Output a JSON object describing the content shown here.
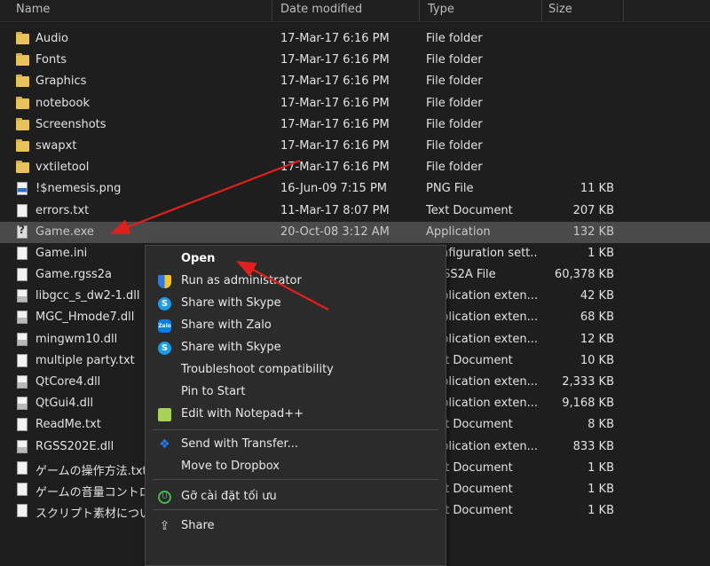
{
  "columns": {
    "name": "Name",
    "date": "Date modified",
    "type": "Type",
    "size": "Size"
  },
  "files": [
    {
      "name": "Audio",
      "date": "17-Mar-17 6:16 PM",
      "type": "File folder",
      "size": "",
      "icon": "folder-icon"
    },
    {
      "name": "Fonts",
      "date": "17-Mar-17 6:16 PM",
      "type": "File folder",
      "size": "",
      "icon": "folder-icon"
    },
    {
      "name": "Graphics",
      "date": "17-Mar-17 6:16 PM",
      "type": "File folder",
      "size": "",
      "icon": "folder-icon"
    },
    {
      "name": "notebook",
      "date": "17-Mar-17 6:16 PM",
      "type": "File folder",
      "size": "",
      "icon": "folder-icon"
    },
    {
      "name": "Screenshots",
      "date": "17-Mar-17 6:16 PM",
      "type": "File folder",
      "size": "",
      "icon": "folder-icon"
    },
    {
      "name": "swapxt",
      "date": "17-Mar-17 6:16 PM",
      "type": "File folder",
      "size": "",
      "icon": "folder-icon"
    },
    {
      "name": "vxtiletool",
      "date": "17-Mar-17 6:16 PM",
      "type": "File folder",
      "size": "",
      "icon": "folder-icon"
    },
    {
      "name": "!$nemesis.png",
      "date": "16-Jun-09 7:15 PM",
      "type": "PNG File",
      "size": "11 KB",
      "icon": "image-file-icon"
    },
    {
      "name": "errors.txt",
      "date": "11-Mar-17 8:07 PM",
      "type": "Text Document",
      "size": "207 KB",
      "icon": "text-file-icon"
    },
    {
      "name": "Game.exe",
      "date": "20-Oct-08 3:12 AM",
      "type": "Application",
      "size": "132 KB",
      "icon": "exe-file-icon",
      "selected": true
    },
    {
      "name": "Game.ini",
      "date": "",
      "type": "Configuration sett...",
      "size": "1 KB",
      "icon": "config-file-icon"
    },
    {
      "name": "Game.rgss2a",
      "date": "",
      "type": "RGSS2A File",
      "size": "60,378 KB",
      "icon": "file-icon"
    },
    {
      "name": "libgcc_s_dw2-1.dll",
      "date": "",
      "type": "Application exten...",
      "size": "42 KB",
      "icon": "dll-file-icon"
    },
    {
      "name": "MGC_Hmode7.dll",
      "date": "",
      "type": "Application exten...",
      "size": "68 KB",
      "icon": "dll-file-icon"
    },
    {
      "name": "mingwm10.dll",
      "date": "",
      "type": "Application exten...",
      "size": "12 KB",
      "icon": "dll-file-icon"
    },
    {
      "name": "multiple party.txt",
      "date": "",
      "type": "Text Document",
      "size": "10 KB",
      "icon": "text-file-icon"
    },
    {
      "name": "QtCore4.dll",
      "date": "",
      "type": "Application exten...",
      "size": "2,333 KB",
      "icon": "dll-file-icon"
    },
    {
      "name": "QtGui4.dll",
      "date": "",
      "type": "Application exten...",
      "size": "9,168 KB",
      "icon": "dll-file-icon"
    },
    {
      "name": "ReadMe.txt",
      "date": "",
      "type": "Text Document",
      "size": "8 KB",
      "icon": "text-file-icon"
    },
    {
      "name": "RGSS202E.dll",
      "date": "",
      "type": "Application exten...",
      "size": "833 KB",
      "icon": "dll-file-icon"
    },
    {
      "name": "ゲームの操作方法.txt",
      "date": "",
      "type": "Text Document",
      "size": "1 KB",
      "icon": "text-file-icon"
    },
    {
      "name": "ゲームの音量コントロール.txt",
      "date": "",
      "type": "Text Document",
      "size": "1 KB",
      "icon": "text-file-icon"
    },
    {
      "name": "スクリプト素材について.txt",
      "date": "",
      "type": "Text Document",
      "size": "1 KB",
      "icon": "text-file-icon"
    }
  ],
  "context_menu": {
    "items": [
      {
        "label": "Open",
        "icon": "",
        "bold": true
      },
      {
        "label": "Run as administrator",
        "icon": "shield-icon"
      },
      {
        "label": "Share with Skype",
        "icon": "skype-icon"
      },
      {
        "label": "Share with Zalo",
        "icon": "zalo-icon"
      },
      {
        "label": "Share with Skype",
        "icon": "skype-icon"
      },
      {
        "label": "Troubleshoot compatibility",
        "icon": ""
      },
      {
        "label": "Pin to Start",
        "icon": ""
      },
      {
        "label": "Edit with Notepad++",
        "icon": "notepad-plus-plus-icon"
      },
      {
        "label": "Send with Transfer...",
        "icon": "dropbox-icon"
      },
      {
        "label": "Move to Dropbox",
        "icon": ""
      },
      {
        "label": "Gỡ cài đặt tối ưu",
        "icon": "uninstall-icon"
      },
      {
        "label": "Share",
        "icon": "share-icon"
      }
    ]
  },
  "colors": {
    "background": "#1e1e1e",
    "selected_row": "#4a4a4a",
    "menu_bg": "#2b2b2b",
    "annotation_arrow": "#e0201c",
    "folder": "#e8c25a"
  }
}
